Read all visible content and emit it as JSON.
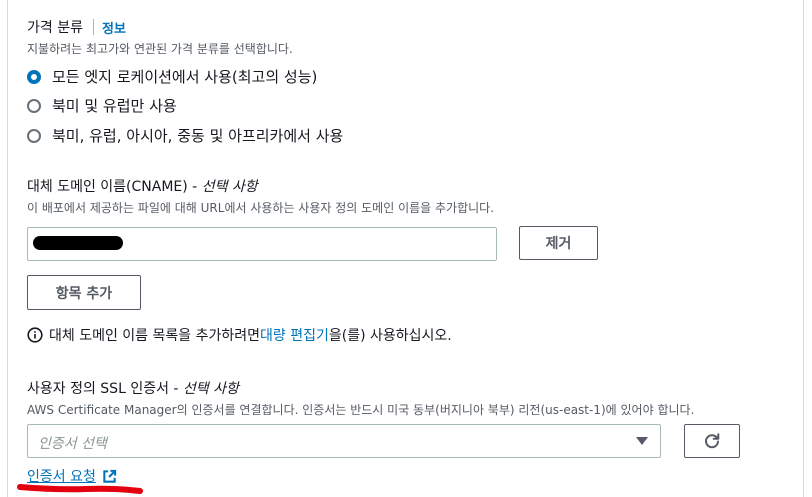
{
  "price_class": {
    "title": "가격 분류",
    "info_label": "정보",
    "description": "지불하려는 최고가와 연관된 가격 분류를 선택합니다.",
    "options": [
      {
        "label": "모든 엣지 로케이션에서 사용(최고의 성능)",
        "selected": true
      },
      {
        "label": "북미 및 유럽만 사용",
        "selected": false
      },
      {
        "label": "북미, 유럽, 아시아, 중동 및 아프리카에서 사용",
        "selected": false
      }
    ]
  },
  "cname": {
    "title": "대체 도메인 이름(CNAME) - ",
    "optional": "선택 사항",
    "description": "이 배포에서 제공하는 파일에 대해 URL에서 사용하는 사용자 정의 도메인 이름을 추가합니다.",
    "remove_label": "제거",
    "add_item_label": "항목 추가",
    "info_text_before": "대체 도메인 이름 목록을 추가하려면 ",
    "info_link": "대량 편집기",
    "info_text_after": "을(를) 사용하십시오."
  },
  "ssl": {
    "title": "사용자 정의 SSL 인증서 - ",
    "optional": "선택 사항",
    "description": "AWS Certificate Manager의 인증서를 연결합니다. 인증서는 반드시 미국 동부(버지니아 북부) 리전(us-east-1)에 있어야 합니다.",
    "select_placeholder": "인증서 선택",
    "request_link": "인증서 요청"
  },
  "colors": {
    "link": "#0073bb",
    "annotation": "#e3000f",
    "border": "#aab7b8"
  },
  "icons": [
    "info-icon",
    "refresh-icon",
    "external-link-icon",
    "caret-down-icon"
  ]
}
